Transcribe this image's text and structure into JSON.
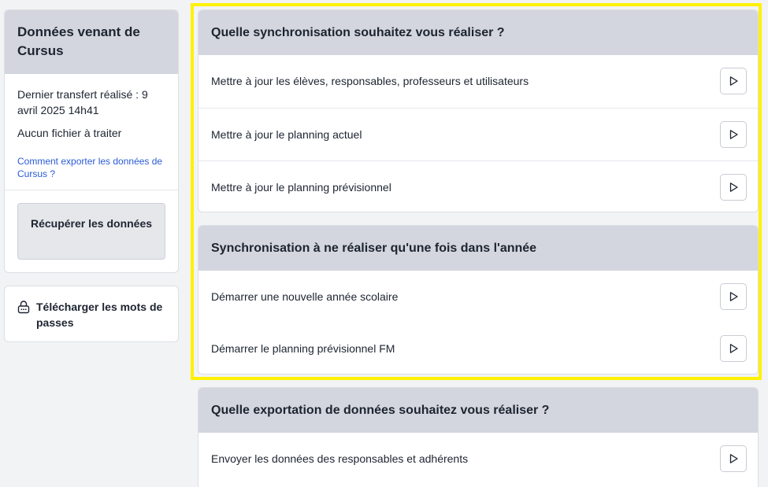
{
  "cursus": {
    "title": "Données venant de Cursus",
    "last_transfer": "Dernier transfert réalisé : 9 avril 2025 14h41",
    "no_file": "Aucun fichier à traiter",
    "help_link": "Comment exporter les données de Cursus ?",
    "fetch_button": "Récupérer les données"
  },
  "passwords": {
    "label": "Télécharger les mots de passes",
    "icon": "lock-icon"
  },
  "sync": {
    "title": "Quelle synchronisation souhaitez vous réaliser ?",
    "rows": [
      {
        "label": "Mettre à jour les élèves, responsables, professeurs et utilisateurs"
      },
      {
        "label": "Mettre à jour le planning actuel"
      },
      {
        "label": "Mettre à jour le planning prévisionnel"
      }
    ]
  },
  "yearly": {
    "title": "Synchronisation à ne réaliser qu'une fois dans l'année",
    "rows": [
      {
        "label": "Démarrer une nouvelle année scolaire"
      },
      {
        "label": "Démarrer le planning prévisionnel FM"
      }
    ]
  },
  "export": {
    "title": "Quelle exportation de données souhaitez vous réaliser ?",
    "rows": [
      {
        "label": "Envoyer les données des responsables et adhérents"
      }
    ]
  },
  "colors": {
    "highlight": "#fff200",
    "header_bg": "#d3d6de",
    "link": "#2a5bd7"
  },
  "icons": {
    "play": "play-icon"
  }
}
